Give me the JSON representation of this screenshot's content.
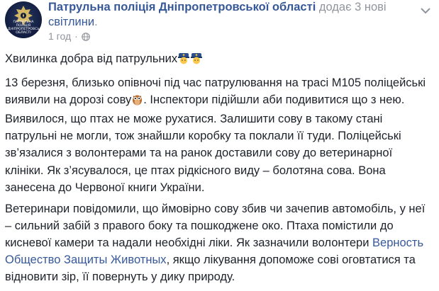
{
  "header": {
    "page_name": "Патрульна поліція Дніпропетровської області",
    "action_text": " додає 3 нові ",
    "photos_link": "світлини",
    "suffix": ".",
    "time": "1 год",
    "dot": "·",
    "avatar_text_line1": "патрульна",
    "avatar_text_line2": "поліція",
    "avatar_text_line3": "дніпропетровської",
    "avatar_text_line4": "області"
  },
  "post": {
    "title": "Хвилинка добра від патрульних",
    "p1_a": "13 березня, близько опівночі під час патрулювання на трасі М105 поліцейські виявили на дорозі сову",
    "p1_b": ". Інспектори підійшли аби подивитися що з нею. Виявилося, що птах не може рухатися. Залишити сову в такому стані патрульні не могли, тож знайшли коробку та поклали її туди. Поліцейські зв’язалися з волонтерами та на ранок доставили сову до ветеринарної клініки. Як з’ясувалося, це птах рідкісного виду – болотяна сова. Вона занесена до Червоної книги України.",
    "p2_a": "Ветеринари повідомили, що ймовірно сову збив чи зачепив автомобіль, у неї – сильний забій з правого боку та пошкоджене око. Птаха помістили до кисневої камери та надали необхідні ліки. Як зазначили волонтери ",
    "p2_link": "Верность Общество Защиты Животных",
    "p2_b": ", якщо лікування допоможе сові оговтатися та відновити зір, її повернуть у дику природу."
  },
  "icons": {
    "globe": "globe-icon",
    "chevron": "chevron-down-icon",
    "police_emoji": "police-officer-emoji",
    "owl_emoji": "owl-emoji",
    "badge": "police-badge-icon"
  },
  "colors": {
    "link": "#365899",
    "meta": "#90949c",
    "text": "#1d2129",
    "avatar_bg": "#0f1b3d"
  }
}
